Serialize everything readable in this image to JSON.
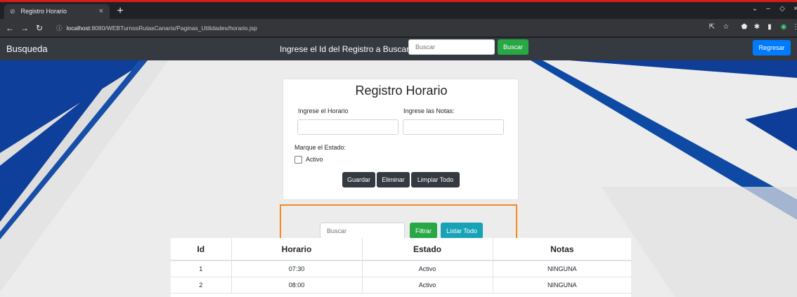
{
  "browser": {
    "tab_title": "Registro Horario",
    "url_host": "localhost",
    "url_rest": ":8080/WEBTurnosRutasCanaris/Paginas_Utilidades/horario.jsp",
    "icons": {
      "tab": "globe-icon",
      "close": "close-icon",
      "newtab": "plus-icon",
      "back": "back-arrow-icon",
      "forward": "forward-arrow-icon",
      "reload": "reload-icon",
      "info": "info-icon",
      "share": "share-icon",
      "bookmark": "star-icon",
      "extension": "puzzle-icon",
      "profile": "profile-icon",
      "menu": "kebab-menu-icon"
    }
  },
  "navbar": {
    "brand": "Busqueda",
    "search_label": "Ingrese el Id del Registro a Buscar",
    "search_placeholder": "Buscar",
    "search_button": "Buscar",
    "back_button": "Regresar"
  },
  "form": {
    "title": "Registro Horario",
    "hora_label": "Ingrese el Horario",
    "notas_label": "Ingrese las Notas:",
    "hora_value": "",
    "notas_value": "",
    "estado_label": "Marque el Estado:",
    "activo_label": "Activo",
    "activo_checked": false,
    "save_button": "Guardar",
    "delete_button": "Eliminar",
    "clear_button": "Limpiar Todo"
  },
  "filter": {
    "placeholder": "Buscar",
    "filter_button": "Filtrar",
    "list_button": "Listar Todo"
  },
  "table": {
    "headers": [
      "Id",
      "Horario",
      "Estado",
      "Notas"
    ],
    "rows": [
      [
        "1",
        "07:30",
        "Activo",
        "NINGUNA"
      ],
      [
        "2",
        "08:00",
        "Activo",
        "NINGUNA"
      ]
    ]
  },
  "colors": {
    "navbar": "#343a40",
    "success": "#28a745",
    "info": "#17a2b8",
    "primary": "#007bff",
    "highlight": "#f28b20",
    "banner_blue": "#0e3f9b"
  }
}
